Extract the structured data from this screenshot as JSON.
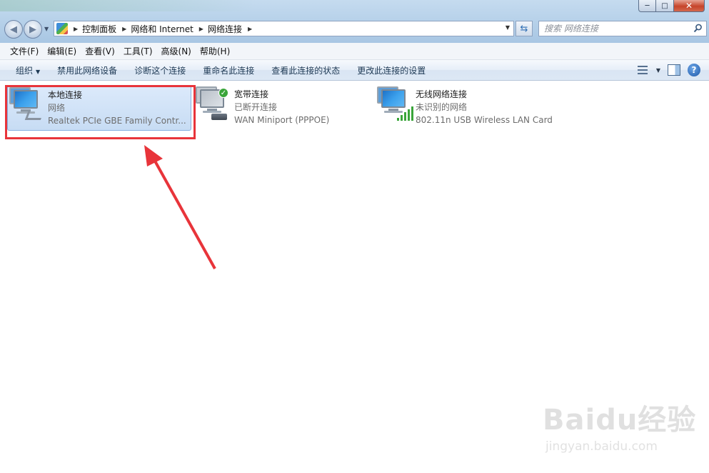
{
  "window": {
    "min_label": "─",
    "max_label": "□",
    "close_label": "✕"
  },
  "address": {
    "crumbs": [
      "控制面板",
      "网络和 Internet",
      "网络连接"
    ],
    "search_placeholder": "搜索 网络连接"
  },
  "menu": [
    "文件(F)",
    "编辑(E)",
    "查看(V)",
    "工具(T)",
    "高级(N)",
    "帮助(H)"
  ],
  "commands": {
    "organize": "组织",
    "disable": "禁用此网络设备",
    "diagnose": "诊断这个连接",
    "rename": "重命名此连接",
    "view_status": "查看此连接的状态",
    "change_settings": "更改此连接的设置"
  },
  "connections": [
    {
      "name": "本地连接",
      "status": "网络",
      "device": "Realtek PCIe GBE Family Contr...",
      "selected": true
    },
    {
      "name": "宽带连接",
      "status": "已断开连接",
      "device": "WAN Miniport (PPPOE)",
      "selected": false
    },
    {
      "name": "无线网络连接",
      "status": "未识别的网络",
      "device": "802.11n USB Wireless LAN Card",
      "selected": false
    }
  ],
  "watermark": {
    "logo": "Baidu经验",
    "url": "jingyan.baidu.com"
  },
  "colors": {
    "highlight": "#e8343a",
    "selection": "#c7dcf4"
  }
}
